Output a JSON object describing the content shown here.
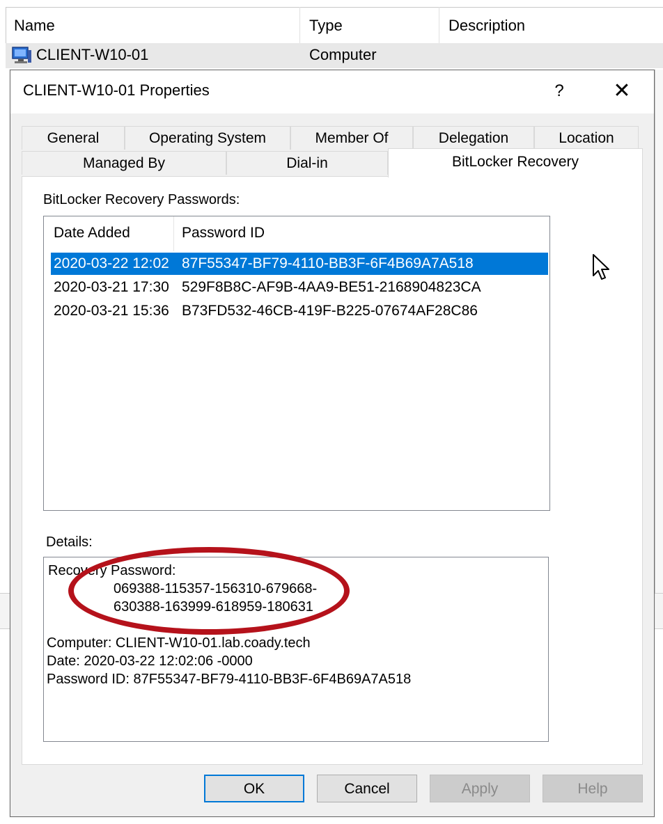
{
  "background_list": {
    "columns": [
      "Name",
      "Type",
      "Description"
    ],
    "row": {
      "name": "CLIENT-W10-01",
      "type": "Computer"
    }
  },
  "dialog": {
    "title": "CLIENT-W10-01 Properties",
    "help_label": "?",
    "close_label": "✕",
    "tabs_row1": [
      "General",
      "Operating System",
      "Member Of",
      "Delegation",
      "Location"
    ],
    "tabs_row2": [
      "Managed By",
      "Dial-in",
      "BitLocker Recovery"
    ],
    "active_tab": "BitLocker Recovery",
    "passwords_label": "BitLocker Recovery Passwords:",
    "list_columns": [
      "Date Added",
      "Password ID"
    ],
    "passwords": [
      {
        "date": "2020-03-22 12:02",
        "id": "87F55347-BF79-4110-BB3F-6F4B69A7A518",
        "selected": true
      },
      {
        "date": "2020-03-21 17:30",
        "id": "529F8B8C-AF9B-4AA9-BE51-2168904823CA",
        "selected": false
      },
      {
        "date": "2020-03-21 15:36",
        "id": "B73FD532-46CB-419F-B225-07674AF28C86",
        "selected": false
      }
    ],
    "details_label": "Details:",
    "details": {
      "recovery_password_label": "Recovery Password:",
      "recovery_password_line1": "069388-115357-156310-679668-",
      "recovery_password_line2": "630388-163999-618959-180631",
      "computer": "Computer: CLIENT-W10-01.lab.coady.tech",
      "date": "Date: 2020-03-22 12:02:06 -0000",
      "password_id": "Password ID: 87F55347-BF79-4110-BB3F-6F4B69A7A518"
    },
    "buttons": {
      "ok": "OK",
      "cancel": "Cancel",
      "apply": "Apply",
      "help": "Help"
    }
  },
  "colors": {
    "selection": "#0078d7",
    "annotation": "#b5121b"
  },
  "icons": [
    "computer-icon",
    "mouse-cursor-icon"
  ]
}
